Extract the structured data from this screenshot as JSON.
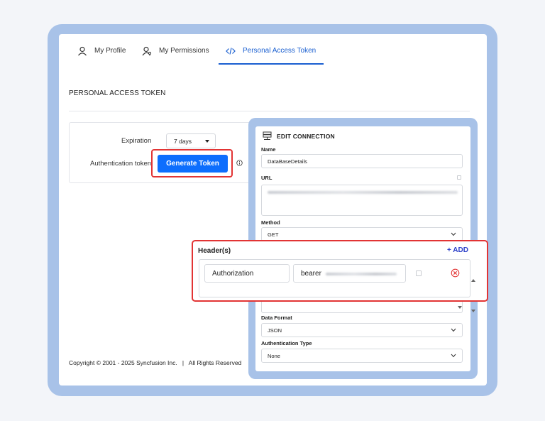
{
  "tabs": [
    {
      "label": "My Profile",
      "icon": "user-icon"
    },
    {
      "label": "My Permissions",
      "icon": "user-key-icon"
    },
    {
      "label": "Personal Access Token",
      "icon": "code-icon",
      "active": true
    }
  ],
  "page_title": "PERSONAL ACCESS TOKEN",
  "token_form": {
    "expiration_label": "Expiration",
    "expiration_value": "7 days",
    "auth_token_label": "Authentication token",
    "generate_button": "Generate Token"
  },
  "footer": "Copyright © 2001 - 2025 Syncfusion Inc.   |   All Rights Reserved",
  "edit_connection": {
    "title": "EDIT CONNECTION",
    "name_label": "Name",
    "name_value": "DataBaseDetails",
    "url_label": "URL",
    "method_label": "Method",
    "method_value": "GET",
    "data_format_label": "Data Format",
    "data_format_value": "JSON",
    "auth_type_label": "Authentication Type",
    "auth_type_value": "None"
  },
  "headers": {
    "title": "Header(s)",
    "add_label": "+ ADD",
    "key_value": "Authorization",
    "value_prefix": "bearer"
  },
  "colors": {
    "accent": "#1a5fd0",
    "primary_button": "#0d6efd",
    "highlight": "#e23434",
    "frame": "#a8c2e8",
    "add_link": "#2d40c9",
    "remove_icon": "#e23434"
  }
}
